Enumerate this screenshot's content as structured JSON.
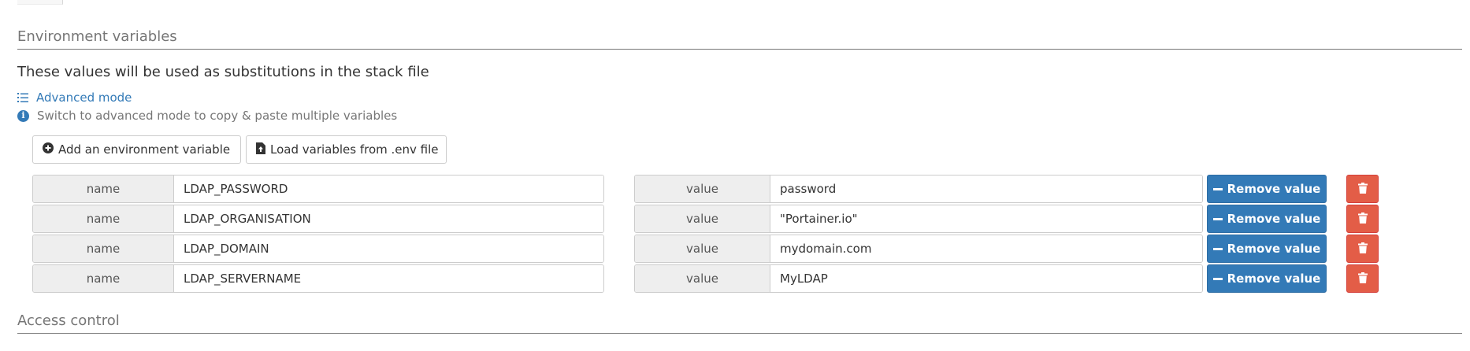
{
  "sections": {
    "environment_title": "Environment variables",
    "access_title": "Access control"
  },
  "subtitle": "These values will be used as substitutions in the stack file",
  "advanced_mode": {
    "label": "Advanced mode",
    "icon": "list-ol-icon"
  },
  "hint": {
    "text": "Switch to advanced mode to copy & paste multiple variables",
    "icon": "info-circle-icon"
  },
  "buttons": {
    "add_env": "Add an environment variable",
    "load_env": "Load variables from .env file",
    "remove_value": "Remove value"
  },
  "labels": {
    "name": "name",
    "value": "value"
  },
  "variables": [
    {
      "name": "LDAP_PASSWORD",
      "value": "password"
    },
    {
      "name": "LDAP_ORGANISATION",
      "value": "\"Portainer.io\""
    },
    {
      "name": "LDAP_DOMAIN",
      "value": "mydomain.com"
    },
    {
      "name": "LDAP_SERVERNAME",
      "value": "MyLDAP"
    }
  ],
  "colors": {
    "primary": "#337ab7",
    "danger": "#e35d47",
    "section_title": "#767676"
  }
}
